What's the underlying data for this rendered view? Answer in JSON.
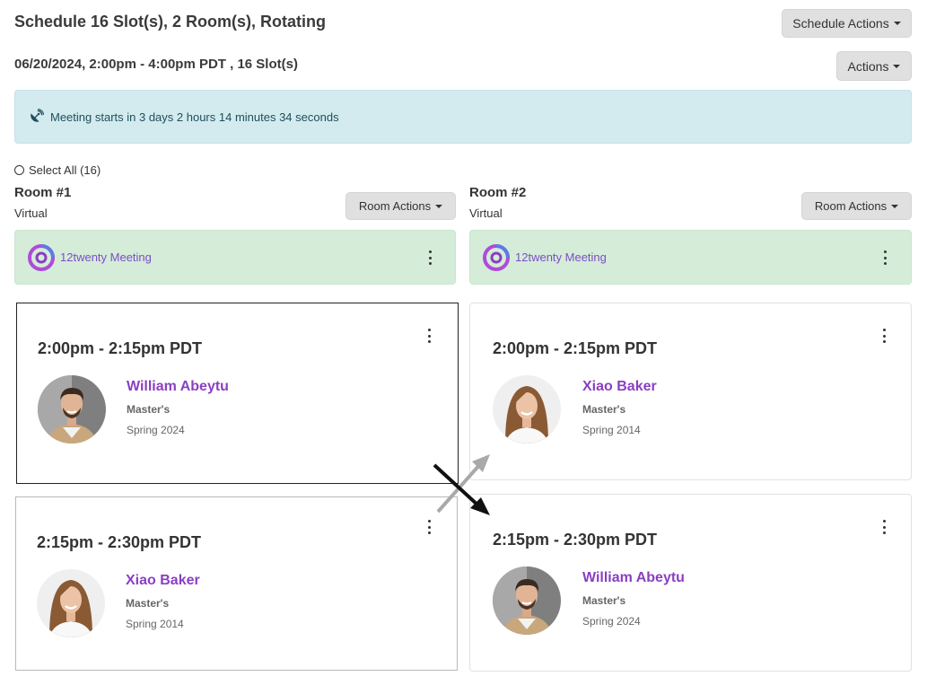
{
  "header": {
    "title": "Schedule 16 Slot(s), 2 Room(s), Rotating",
    "subtitle": "06/20/2024, 2:00pm - 4:00pm PDT , 16 Slot(s)",
    "schedule_actions_label": "Schedule Actions",
    "actions_label": "Actions"
  },
  "alert": {
    "icon": "satellite-dish-icon",
    "text": "Meeting starts in 3 days 2 hours 14 minutes 34 seconds"
  },
  "select_all": {
    "label": "Select All (16)"
  },
  "rooms": [
    {
      "title": "Room #1",
      "type": "Virtual",
      "actions_label": "Room Actions",
      "meeting": "12twenty Meeting",
      "slots": [
        {
          "time": "2:00pm - 2:15pm PDT",
          "name": "William Abeytu",
          "degree": "Master's",
          "term": "Spring 2024"
        },
        {
          "time": "2:15pm - 2:30pm PDT",
          "name": "Xiao Baker",
          "degree": "Master's",
          "term": "Spring 2014"
        }
      ]
    },
    {
      "title": "Room #2",
      "type": "Virtual",
      "actions_label": "Room Actions",
      "meeting": "12twenty Meeting",
      "slots": [
        {
          "time": "2:00pm - 2:15pm PDT",
          "name": "Xiao Baker",
          "degree": "Master's",
          "term": "Spring 2014"
        },
        {
          "time": "2:15pm - 2:30pm PDT",
          "name": "William Abeytu",
          "degree": "Master's",
          "term": "Spring 2024"
        }
      ]
    }
  ],
  "colors": {
    "alert_bg": "#d3ebef",
    "meeting_bg": "#d5ecd9",
    "name_purple": "#8a3fc2",
    "button_gray": "#e0e0e0"
  }
}
